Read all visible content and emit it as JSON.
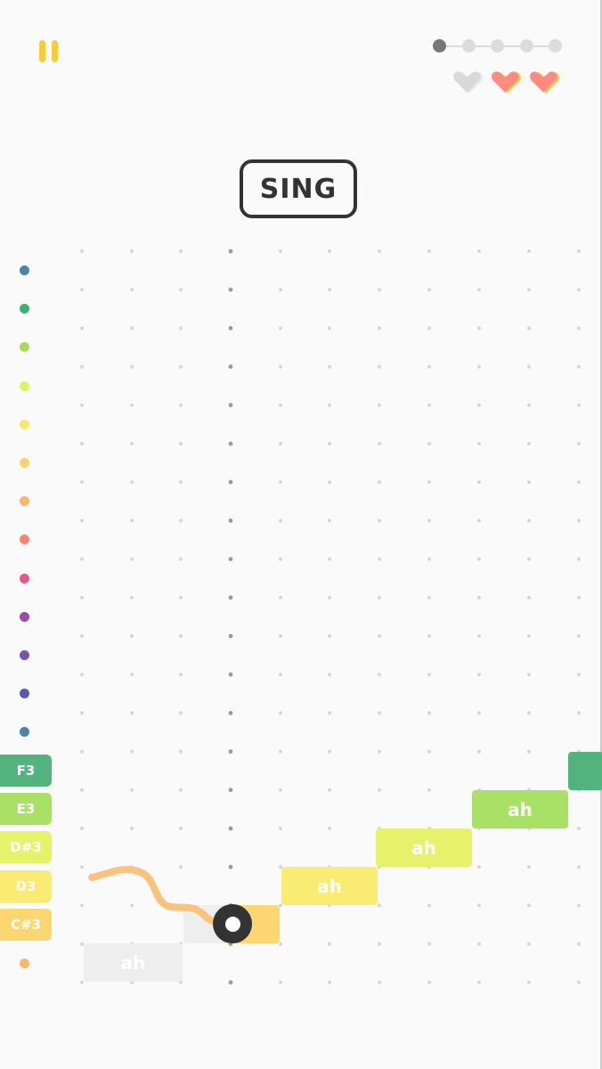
{
  "hud": {
    "pause_icon": "pause-icon",
    "progress": {
      "total": 5,
      "current": 1,
      "active_color": "#777777",
      "inactive_color": "#dcdcdc"
    },
    "lives": {
      "total": 3,
      "remaining": 2,
      "full_color": "#ff8a80",
      "full_shadow": "#ffc857",
      "lost_color": "#d9d9d9",
      "icon": "heart-icon"
    }
  },
  "prompt": {
    "label": "SING"
  },
  "pitch_dots": [
    {
      "color": "#4a84a6"
    },
    {
      "color": "#3fae6e"
    },
    {
      "color": "#a6db5e"
    },
    {
      "color": "#def266"
    },
    {
      "color": "#f7e76a"
    },
    {
      "color": "#f9d26a"
    },
    {
      "color": "#f7b86c"
    },
    {
      "color": "#f5866e"
    },
    {
      "color": "#e1588a"
    },
    {
      "color": "#9b4aa6"
    },
    {
      "color": "#7a52b0"
    },
    {
      "color": "#5a5ab0"
    },
    {
      "color": "#4a84a6"
    }
  ],
  "note_labels": [
    {
      "note": "F3",
      "color": "#52b37e"
    },
    {
      "note": "E3",
      "color": "#a9e066"
    },
    {
      "note": "D#3",
      "color": "#e5f26a"
    },
    {
      "note": "D3",
      "color": "#faec73"
    },
    {
      "note": "C#3",
      "color": "#fbd671"
    }
  ],
  "bottom_dot": {
    "color": "#f7b86c"
  },
  "note_blocks": [
    {
      "syllable": "ah",
      "color": "#eeeeee",
      "state": "passed",
      "pitch": "C3"
    },
    {
      "syllable": "",
      "color": "#fbd671",
      "state": "current",
      "pitch": "C#3"
    },
    {
      "syllable": "ah",
      "color": "#faec73",
      "state": "upcoming",
      "pitch": "D3"
    },
    {
      "syllable": "ah",
      "color": "#e5f26a",
      "state": "upcoming",
      "pitch": "D#3"
    },
    {
      "syllable": "ah",
      "color": "#a9e066",
      "state": "upcoming",
      "pitch": "E3"
    },
    {
      "syllable": "",
      "color": "#52b37e",
      "state": "upcoming",
      "pitch": "F3"
    }
  ],
  "voice_trail": {
    "color": "#f9c27d"
  },
  "player_cursor": {
    "icon": "voice-cursor-icon"
  }
}
